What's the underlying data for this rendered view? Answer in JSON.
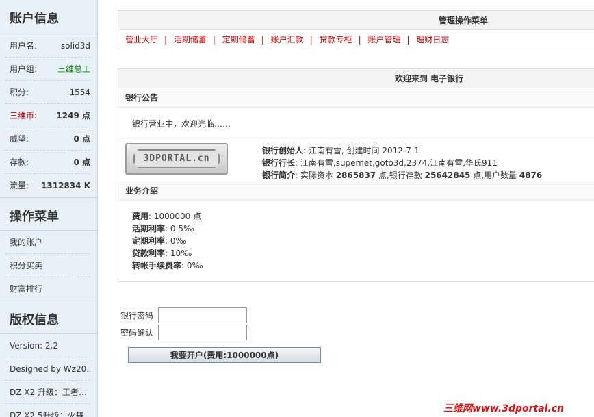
{
  "sidebar": {
    "account_title": "账户信息",
    "account_rows": [
      {
        "label": "用户名:",
        "value": "solid3d"
      },
      {
        "label": "用户组:",
        "value": "三维总工"
      },
      {
        "label": "积分:",
        "value": "1554"
      },
      {
        "label": "三维币:",
        "value": "1249 点"
      },
      {
        "label": "威望:",
        "value": "0 点"
      },
      {
        "label": "存款:",
        "value": "0 点"
      },
      {
        "label": "流量:",
        "value": "1312834 K"
      }
    ],
    "menu_title": "操作菜单",
    "menu_items": [
      "我的账户",
      "积分买卖",
      "财富排行"
    ],
    "copyright_title": "版权信息",
    "copyright_items": [
      "Version: 2.2",
      "Designed by Wz20…",
      "DZ X2 升级：王者…",
      "DZ X2.5升级：火舞…"
    ]
  },
  "menu_panel": {
    "title": "管理操作菜单",
    "nav": [
      "营业大厅",
      "活期储蓄",
      "定期储蓄",
      "账户汇款",
      "贷款专柜",
      "账户管理",
      "理财日志"
    ],
    "separator": "|"
  },
  "bank_panel": {
    "title": "欢迎来到 电子银行",
    "notice_title": "银行公告",
    "notice_text": "银行营业中，欢迎光临……",
    "logo_text": "3DPORTAL.cn",
    "founder_label": "银行创始人",
    "founder_value": ": 江南有雪, 创建时间  2012-7-1",
    "president_label": "银行行长",
    "president_value": ": 江南有雪,supernet,goto3d,2374,江南有雪,华氏911",
    "intro_label": "银行简介",
    "intro_pre": ": 实际资本 ",
    "capital": "2865837",
    "intro_mid": " 点,银行存款 ",
    "deposit": "25642845",
    "intro_mid2": " 点,用户数量 ",
    "users": "4876",
    "business_title": "业务介绍",
    "business": [
      {
        "label": "费用",
        "value": ": 1000000 点"
      },
      {
        "label": "活期利率",
        "value": ": 0.5‰"
      },
      {
        "label": "定期利率",
        "value": ": 0‰"
      },
      {
        "label": "贷款利率",
        "value": ": 10‰"
      },
      {
        "label": "转帐手续费率",
        "value": ": 0‰"
      }
    ]
  },
  "form": {
    "password_label": "银行密码",
    "confirm_label": "密码确认",
    "submit_label": "我要开户(费用:1000000点)"
  },
  "watermark": "三维网www.3dportal.cn"
}
